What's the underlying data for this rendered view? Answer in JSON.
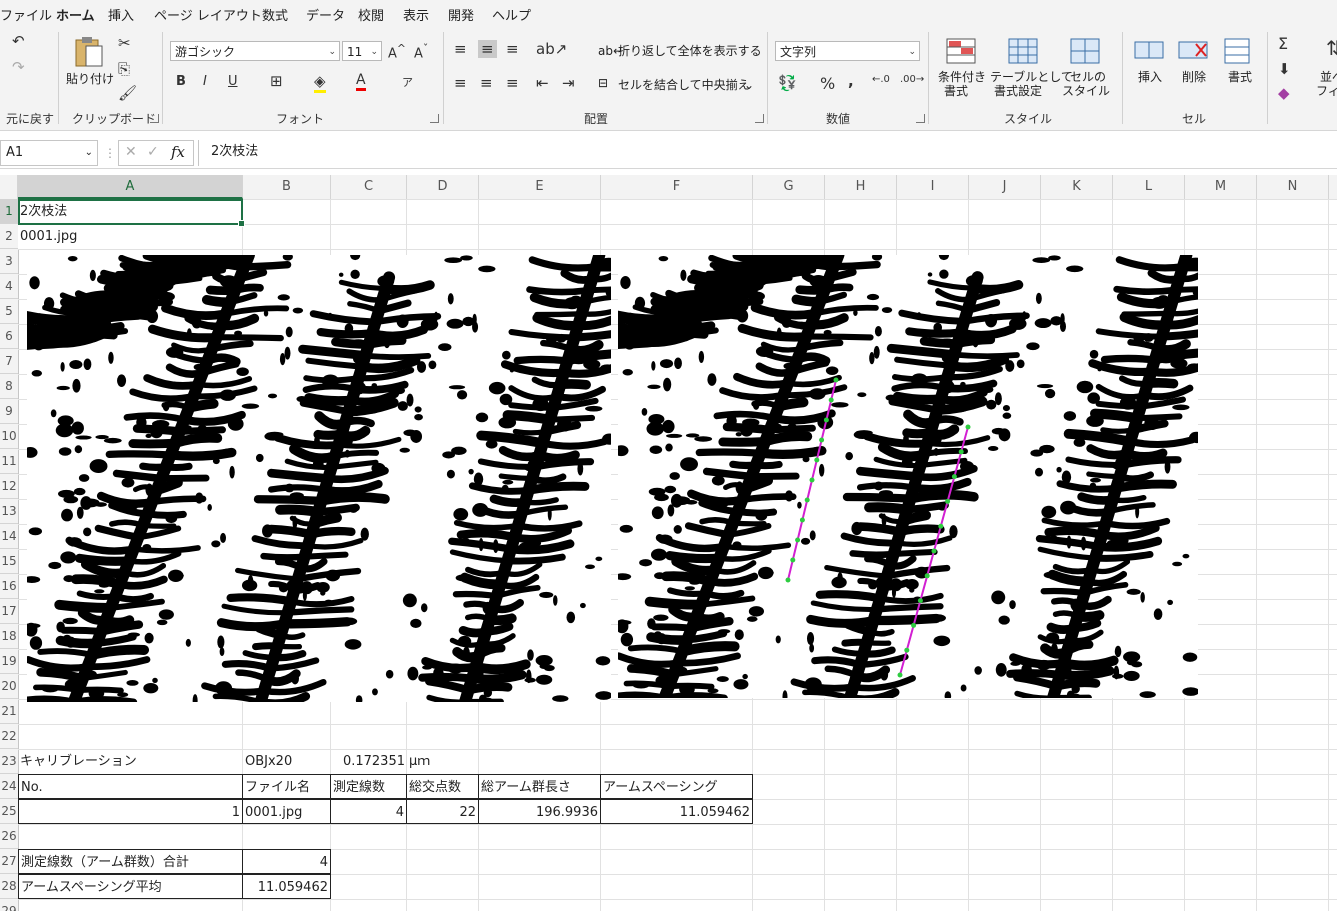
{
  "menu": [
    "ファイル",
    "ホーム",
    "挿入",
    "ページ レイアウト",
    "数式",
    "データ",
    "校閲",
    "表示",
    "開発",
    "ヘルプ"
  ],
  "ribbon": {
    "undo_label": "元に戻す",
    "clipboard": {
      "paste": "貼り付け",
      "label": "クリップボード"
    },
    "font": {
      "name": "游ゴシック",
      "size": "11",
      "label": "フォント"
    },
    "alignment": {
      "wrap": "折り返して全体を表示する",
      "merge": "セルを結合して中央揃え",
      "label": "配置"
    },
    "number": {
      "format": "文字列",
      "label": "数値"
    },
    "styles": {
      "conditional": [
        "条件付き",
        "書式"
      ],
      "table": [
        "テーブルとして",
        "書式設定"
      ],
      "cell": [
        "セルの",
        "スタイル"
      ],
      "label": "スタイル"
    },
    "cells": {
      "insert": "挿入",
      "delete": "削除",
      "format": "書式",
      "label": "セル"
    },
    "editing": {
      "sort": [
        "並べ",
        "フィル"
      ]
    }
  },
  "formula_bar": {
    "name_box": "A1",
    "formula": "2次枝法"
  },
  "columns": [
    "A",
    "B",
    "C",
    "D",
    "E",
    "F",
    "G",
    "H",
    "I",
    "J",
    "K",
    "L",
    "M",
    "N"
  ],
  "rows": [
    "1",
    "2",
    "3",
    "4",
    "5",
    "6",
    "7",
    "8",
    "9",
    "10",
    "11",
    "12",
    "13",
    "14",
    "15",
    "16",
    "17",
    "18",
    "19",
    "20",
    "21",
    "22",
    "23",
    "24",
    "25",
    "26",
    "27",
    "28",
    "29"
  ],
  "sheet": {
    "a1": "2次枝法",
    "a2": "0001.jpg",
    "calibration": {
      "label": "キャリブレーション",
      "objective": "OBJx20",
      "value": "0.172351",
      "unit": "μｍ"
    },
    "table_header": [
      "No.",
      "ファイル名",
      "測定線数",
      "総交点数",
      "総アーム群長さ",
      "アームスペーシング"
    ],
    "table_row": [
      "1",
      "0001.jpg",
      "4",
      "22",
      "196.9936",
      "11.059462"
    ],
    "summary": [
      {
        "label": "測定線数（アーム群数）合計",
        "value": "4"
      },
      {
        "label": "アームスペーシング平均",
        "value": "11.059462"
      }
    ]
  },
  "colors": {
    "accent": "#1e7145",
    "measure_line": "#d21fd2",
    "marker": "#2ecc40"
  }
}
